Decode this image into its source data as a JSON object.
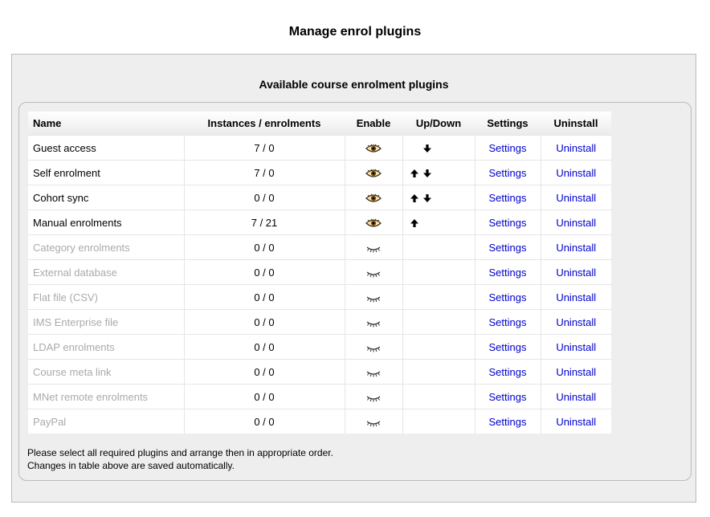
{
  "page": {
    "title": "Manage enrol plugins"
  },
  "section": {
    "title": "Available course enrolment plugins"
  },
  "table": {
    "headers": {
      "name": "Name",
      "instances": "Instances / enrolments",
      "enable": "Enable",
      "updown": "Up/Down",
      "settings": "Settings",
      "uninstall": "Uninstall"
    },
    "rows": [
      {
        "name": "Guest access",
        "instances": "7 / 0",
        "enabled": true,
        "up": false,
        "down": true,
        "settings": "Settings",
        "uninstall": "Uninstall"
      },
      {
        "name": "Self enrolment",
        "instances": "7 / 0",
        "enabled": true,
        "up": true,
        "down": true,
        "settings": "Settings",
        "uninstall": "Uninstall"
      },
      {
        "name": "Cohort sync",
        "instances": "0 / 0",
        "enabled": true,
        "up": true,
        "down": true,
        "settings": "Settings",
        "uninstall": "Uninstall"
      },
      {
        "name": "Manual enrolments",
        "instances": "7 / 21",
        "enabled": true,
        "up": true,
        "down": false,
        "settings": "Settings",
        "uninstall": "Uninstall"
      },
      {
        "name": "Category enrolments",
        "instances": "0 / 0",
        "enabled": false,
        "up": false,
        "down": false,
        "settings": "Settings",
        "uninstall": "Uninstall"
      },
      {
        "name": "External database",
        "instances": "0 / 0",
        "enabled": false,
        "up": false,
        "down": false,
        "settings": "Settings",
        "uninstall": "Uninstall"
      },
      {
        "name": "Flat file (CSV)",
        "instances": "0 / 0",
        "enabled": false,
        "up": false,
        "down": false,
        "settings": "Settings",
        "uninstall": "Uninstall"
      },
      {
        "name": "IMS Enterprise file",
        "instances": "0 / 0",
        "enabled": false,
        "up": false,
        "down": false,
        "settings": "Settings",
        "uninstall": "Uninstall"
      },
      {
        "name": "LDAP enrolments",
        "instances": "0 / 0",
        "enabled": false,
        "up": false,
        "down": false,
        "settings": "Settings",
        "uninstall": "Uninstall"
      },
      {
        "name": "Course meta link",
        "instances": "0 / 0",
        "enabled": false,
        "up": false,
        "down": false,
        "settings": "Settings",
        "uninstall": "Uninstall"
      },
      {
        "name": "MNet remote enrolments",
        "instances": "0 / 0",
        "enabled": false,
        "up": false,
        "down": false,
        "settings": "Settings",
        "uninstall": "Uninstall"
      },
      {
        "name": "PayPal",
        "instances": "0 / 0",
        "enabled": false,
        "up": false,
        "down": false,
        "settings": "Settings",
        "uninstall": "Uninstall"
      }
    ]
  },
  "notes": {
    "line1": "Please select all required plugins and arrange then in appropriate order.",
    "line2": "Changes in table above are saved automatically."
  },
  "colors": {
    "link": "#0000cc",
    "disabled_text": "#aaaaaa",
    "panel_bg": "#eeeeee"
  },
  "icons": {
    "enabled": "open-eye-icon",
    "disabled": "closed-eye-icon",
    "up": "up-arrow-icon",
    "down": "down-arrow-icon"
  }
}
